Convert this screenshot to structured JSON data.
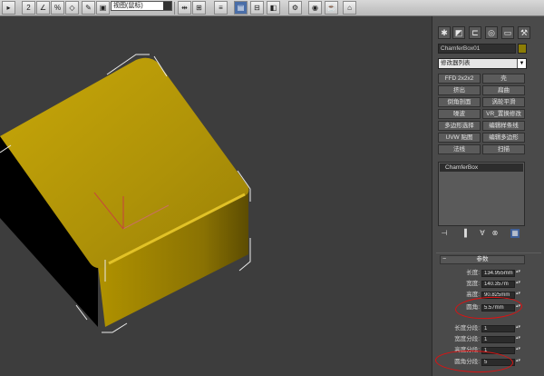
{
  "toolbar": {
    "dropdown_value": "视图(鼠标)",
    "icons": [
      "2-snap-icon",
      "angle-snap-icon",
      "percent-snap-icon",
      "spinner-snap-icon",
      "named-selection-icon",
      "mirror-icon",
      "align-icon",
      "layer-icon",
      "curve-editor-icon",
      "schematic-icon",
      "material-editor-icon",
      "render-setup-icon",
      "rendered-frame-icon",
      "render-icon",
      "render-activeshade-icon",
      "teapot-icon"
    ]
  },
  "panel": {
    "tabs": [
      "create-icon",
      "modify-icon",
      "hierarchy-icon",
      "motion-icon",
      "display-icon",
      "utilities-icon"
    ],
    "object_name": "ChamferBox01",
    "object_color": "#8c7d06",
    "modifier_list": "修改器列表",
    "modifier_buttons": [
      [
        "FFD 2x2x2",
        "壳"
      ],
      [
        "挤出",
        "扁曲"
      ],
      [
        "倒角剖面",
        "涡轮平滑"
      ],
      [
        "噪波",
        "VR_置换修改"
      ],
      [
        "多边形选择",
        "编辑样条线"
      ],
      [
        "UVW 贴图",
        "编辑多边形"
      ],
      [
        "法线",
        "扫描"
      ]
    ],
    "stack_item": "ChamferBox",
    "params": {
      "title": "参数",
      "rows": [
        {
          "label": "长度:",
          "value": "134.955mm"
        },
        {
          "label": "宽度:",
          "value": "140.357m"
        },
        {
          "label": "高度:",
          "value": "90.825mm"
        },
        {
          "label": "圆角:",
          "value": "5.57mm"
        },
        {
          "label": "长度分段:",
          "value": "1"
        },
        {
          "label": "宽度分段:",
          "value": "1"
        },
        {
          "label": "高度分段:",
          "value": "1"
        },
        {
          "label": "圆角分段:",
          "value": "5"
        }
      ]
    }
  }
}
